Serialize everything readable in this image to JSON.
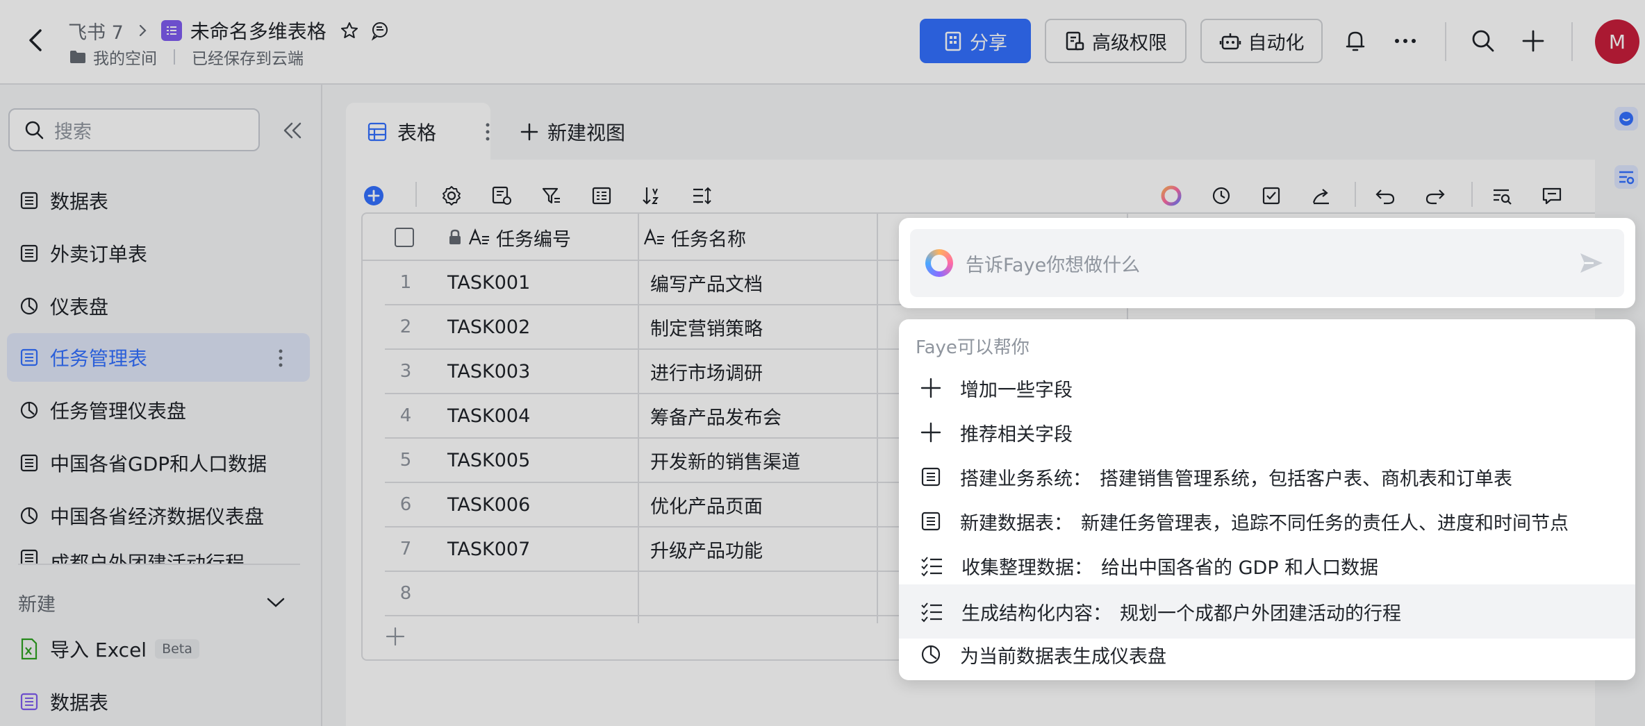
{
  "header": {
    "space": "飞书 7",
    "title": "未命名多维表格",
    "folder": "我的空间",
    "save_status": "已经保存到云端",
    "share_label": "分享",
    "permission_label": "高级权限",
    "automation_label": "自动化",
    "avatar_letter": "M"
  },
  "sidebar": {
    "search_placeholder": "搜索",
    "items": [
      {
        "label": "数据表",
        "icon": "table-icon"
      },
      {
        "label": "外卖订单表",
        "icon": "table-icon"
      },
      {
        "label": "仪表盘",
        "icon": "dashboard-icon"
      },
      {
        "label": "任务管理表",
        "icon": "table-icon",
        "active": true
      },
      {
        "label": "任务管理仪表盘",
        "icon": "dashboard-icon"
      },
      {
        "label": "中国各省GDP和人口数据",
        "icon": "table-icon"
      },
      {
        "label": "中国各省经济数据仪表盘",
        "icon": "dashboard-icon"
      },
      {
        "label": "成都户外团建活动行程",
        "icon": "table-icon"
      }
    ],
    "new_section": {
      "label": "新建",
      "import_excel": "导入 Excel",
      "beta": "Beta",
      "new_table": "数据表"
    }
  },
  "tabs": {
    "active": "表格",
    "new_view": "新建视图"
  },
  "table": {
    "columns": [
      "任务编号",
      "任务名称"
    ],
    "rows": [
      {
        "no": "1",
        "id": "TASK001",
        "name": "编写产品文档"
      },
      {
        "no": "2",
        "id": "TASK002",
        "name": "制定营销策略"
      },
      {
        "no": "3",
        "id": "TASK003",
        "name": "进行市场调研"
      },
      {
        "no": "4",
        "id": "TASK004",
        "name": "筹备产品发布会"
      },
      {
        "no": "5",
        "id": "TASK005",
        "name": "开发新的销售渠道"
      },
      {
        "no": "6",
        "id": "TASK006",
        "name": "优化产品页面"
      },
      {
        "no": "7",
        "id": "TASK007",
        "name": "升级产品功能"
      },
      {
        "no": "8",
        "id": "",
        "name": ""
      }
    ]
  },
  "ai": {
    "placeholder": "告诉Faye你想做什么",
    "panel_title": "Faye可以帮你",
    "items": [
      {
        "icon": "plus-icon",
        "label": "增加一些字段",
        "desc": ""
      },
      {
        "icon": "plus-icon",
        "label": "推荐相关字段",
        "desc": ""
      },
      {
        "icon": "table-icon",
        "label": "搭建业务系统：",
        "desc": "搭建销售管理系统，包括客户表、商机表和订单表"
      },
      {
        "icon": "table-icon",
        "label": "新建数据表：",
        "desc": "新建任务管理表，追踪不同任务的责任人、进度和时间节点"
      },
      {
        "icon": "checklist-icon",
        "label": "收集整理数据：",
        "desc": "给出中国各省的 GDP 和人口数据"
      },
      {
        "icon": "checklist-icon",
        "label": "生成结构化内容：",
        "desc": "规划一个成都户外团建活动的行程",
        "highlight": true
      },
      {
        "icon": "dashboard-icon",
        "label": "为当前数据表生成仪表盘",
        "desc": ""
      }
    ]
  },
  "colors": {
    "accent": "#3370ff",
    "base_icon": "#7f5cf0",
    "avatar": "#c81e3b"
  }
}
